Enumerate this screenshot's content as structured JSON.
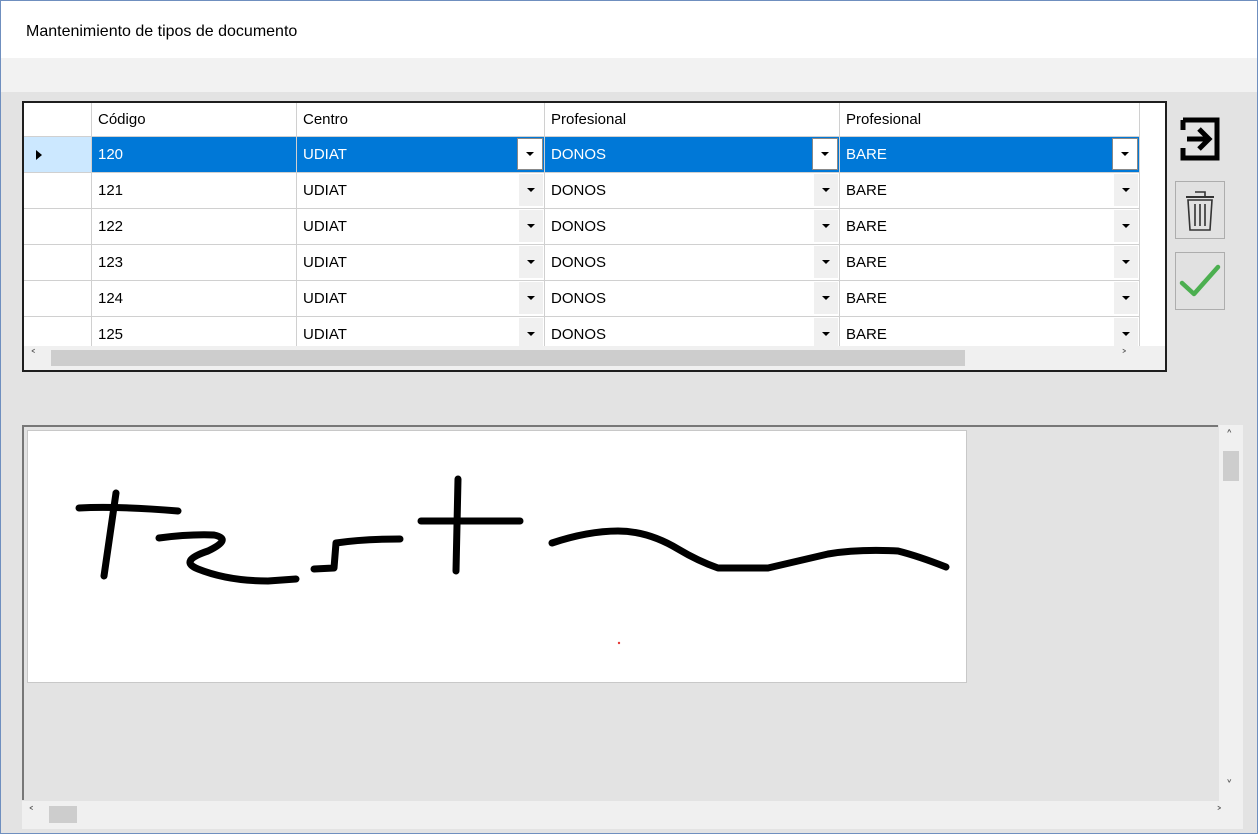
{
  "window": {
    "title": "Mantenimiento de tipos de documento"
  },
  "grid": {
    "columns": [
      "Código",
      "Centro",
      "Profesional",
      "Profesional"
    ],
    "rows": [
      {
        "codigo": "120",
        "centro": "UDIAT",
        "profesional1": "DONOS",
        "profesional2": "BARE"
      },
      {
        "codigo": "121",
        "centro": "UDIAT",
        "profesional1": "DONOS",
        "profesional2": "BARE"
      },
      {
        "codigo": "122",
        "centro": "UDIAT",
        "profesional1": "DONOS",
        "profesional2": "BARE"
      },
      {
        "codigo": "123",
        "centro": "UDIAT",
        "profesional1": "DONOS",
        "profesional2": "BARE"
      },
      {
        "codigo": "124",
        "centro": "UDIAT",
        "profesional1": "DONOS",
        "profesional2": "BARE"
      },
      {
        "codigo": "125",
        "centro": "UDIAT",
        "profesional1": "DONOS",
        "profesional2": "BARE"
      }
    ],
    "selected_row": 0
  },
  "buttons": {
    "exit_icon": "exit-arrow-icon",
    "delete_icon": "trash-icon",
    "save_icon": "checkmark-icon"
  },
  "colors": {
    "selection": "#0078d7",
    "check": "#4caf50"
  }
}
